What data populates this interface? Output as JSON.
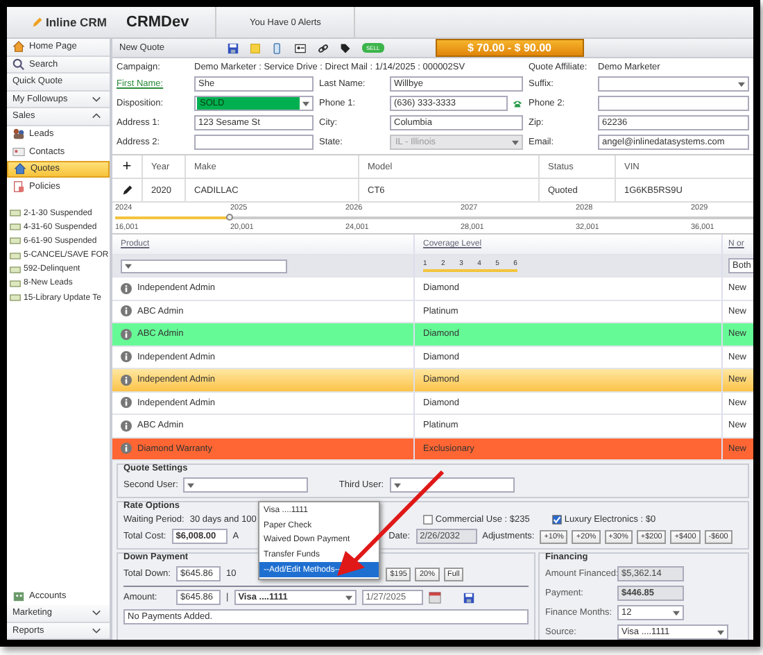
{
  "header": {
    "logo": "Inline CRM",
    "environment": "CRMDev",
    "alerts": "You Have 0 Alerts"
  },
  "sidebar": {
    "nav": [
      {
        "kind": "page",
        "label": "Home Page"
      },
      {
        "kind": "page",
        "label": "Search"
      },
      {
        "kind": "plain",
        "label": "Quick Quote"
      },
      {
        "kind": "group",
        "label": "My Followups",
        "expanded": false
      },
      {
        "kind": "group",
        "label": "Sales",
        "expanded": true
      },
      {
        "kind": "entry",
        "label": "Leads",
        "selected": false
      },
      {
        "kind": "entry",
        "label": "Contacts",
        "selected": false
      },
      {
        "kind": "entry",
        "label": "Quotes",
        "selected": true
      },
      {
        "kind": "entry",
        "label": "Policies",
        "selected": false
      }
    ],
    "queues": [
      "2-1-30 Suspended",
      "4-31-60 Suspended",
      "6-61-90 Suspended",
      "5-CANCEL/SAVE FOR",
      "592-Delinquent",
      "8-New Leads",
      "15-Library Update Te"
    ],
    "footer": [
      {
        "kind": "entry",
        "label": "Accounts",
        "selected": false
      },
      {
        "kind": "group",
        "label": "Marketing",
        "expanded": false
      },
      {
        "kind": "group",
        "label": "Reports",
        "expanded": false
      }
    ]
  },
  "toolbar": {
    "title": "New Quote",
    "badge": "SELL",
    "price": "$ 70.00 - $ 90.00"
  },
  "form": {
    "campaign_label": "Campaign:",
    "campaign": "Demo Marketer : Service Drive : Direct Mail : 1/14/2025 : 000002SV",
    "affiliate_label": "Quote Affiliate:",
    "affiliate": "Demo Marketer",
    "fields": [
      {
        "label": "First Name:",
        "kind": "text",
        "value": "She",
        "link": true,
        "disabled": false
      },
      {
        "label": "Last Name:",
        "kind": "text",
        "value": "Willbye",
        "link": false,
        "disabled": false
      },
      {
        "label": "Suffix:",
        "kind": "select",
        "link": false,
        "disabled": false
      },
      {
        "label": "Disposition:",
        "kind": "select",
        "value": "SOLD",
        "color": "#00b050",
        "link": false,
        "disabled": false
      },
      {
        "label": "Phone 1:",
        "kind": "phone",
        "value": "(636) 333-3333",
        "link": false,
        "disabled": false
      },
      {
        "label": "Phone 2:",
        "kind": "text",
        "link": false,
        "disabled": false
      },
      {
        "label": "Address 1:",
        "kind": "text",
        "value": "123 Sesame St",
        "link": false,
        "disabled": false
      },
      {
        "label": "City:",
        "kind": "text",
        "value": "Columbia",
        "link": false,
        "disabled": false
      },
      {
        "label": "Zip:",
        "kind": "text",
        "value": "62236",
        "link": false,
        "disabled": false
      },
      {
        "label": "Address 2:",
        "kind": "text",
        "link": false,
        "disabled": false
      },
      {
        "label": "State:",
        "kind": "select",
        "value": "IL - Illinois",
        "link": false,
        "disabled": true
      },
      {
        "label": "Email:",
        "kind": "text",
        "value": "angel@inlinedatasystems.com",
        "link": false,
        "disabled": false
      }
    ]
  },
  "vehicles": {
    "add": "+",
    "columns": [
      "Year",
      "Make",
      "Model",
      "Status",
      "VIN"
    ],
    "rows": [
      {
        "cells": [
          "2020",
          "CADILLAC",
          "CT6",
          "Quoted",
          "1G6KB5RS9U"
        ]
      }
    ]
  },
  "timeline": {
    "years": [
      "2024",
      "2025",
      "2026",
      "2027",
      "2028",
      "2029"
    ],
    "miles": [
      "16,001",
      "20,001",
      "24,001",
      "28,001",
      "32,001",
      "36,001"
    ],
    "level": 0.18
  },
  "coverage": {
    "columns": [
      "Product",
      "Coverage Level",
      "N or"
    ],
    "levels": [
      "1",
      "2",
      "3",
      "4",
      "5",
      "6"
    ],
    "level": 1,
    "type_filter": "Both",
    "rows": [
      {
        "product": "Independent Admin",
        "coverage": "Diamond",
        "type": "New",
        "selected": false
      },
      {
        "product": "ABC Admin",
        "coverage": "Platinum",
        "type": "New",
        "selected": false
      },
      {
        "product": "ABC Admin",
        "coverage": "Diamond",
        "type": "New",
        "selected": false,
        "color": "#66fa96"
      },
      {
        "product": "Independent Admin",
        "coverage": "Diamond",
        "type": "New",
        "selected": false
      },
      {
        "product": "Independent Admin",
        "coverage": "Diamond",
        "type": "New",
        "selected": true
      },
      {
        "product": "Independent Admin",
        "coverage": "Diamond",
        "type": "New",
        "selected": false
      },
      {
        "product": "ABC Admin",
        "coverage": "Platinum",
        "type": "New",
        "selected": false
      },
      {
        "product": "Diamond Warranty",
        "coverage": "Exclusionary",
        "type": "New",
        "selected": false,
        "color": "#ff6633"
      }
    ]
  },
  "quote_settings": {
    "title": "Quote Settings",
    "second_user": "Second User:",
    "third_user": "Third User:"
  },
  "rate_options": {
    "title": "Rate Options",
    "waiting_label": "Waiting Period:",
    "waiting": "30 days and 100",
    "checkboxes": [
      {
        "label": "Commercial Use : $235",
        "checked": false
      },
      {
        "label": "Luxury Electronics : $0",
        "checked": true
      }
    ],
    "total_label": "Total Cost:",
    "total": "$6,008.00",
    "cut_label": "A",
    "date_label": "Date:",
    "date": "2/26/2032",
    "adjust_label": "Adjustments:",
    "adjustments": [
      "+10%",
      "+20%",
      "+30%",
      "+$200",
      "+$400",
      "-$600"
    ]
  },
  "down_payment": {
    "title": "Down Payment",
    "total_label": "Total Down:",
    "total": "$645.86",
    "cut_text": "10",
    "buttons": [
      "$195",
      "20%",
      "Full"
    ],
    "amount_label": "Amount:",
    "amount": "$645.86",
    "separator": "|",
    "method": "Visa ....1111",
    "date": "1/27/2025",
    "empty": "No Payments Added."
  },
  "financing": {
    "title": "Financing",
    "rows": [
      {
        "label": "Amount Financed:",
        "value": "$5,362.14",
        "kind": "readonly"
      },
      {
        "label": "Payment:",
        "value": "$446.85",
        "kind": "readonly"
      },
      {
        "label": "Finance Months:",
        "value": "12",
        "kind": "combo"
      },
      {
        "label": "Source:",
        "value": "Visa ....1111",
        "kind": "dropdown"
      }
    ]
  },
  "payment_menu": {
    "options": [
      {
        "label": "Visa ....1111",
        "selected": false
      },
      {
        "label": "Paper Check",
        "selected": false
      },
      {
        "label": "Waived Down Payment",
        "selected": false
      },
      {
        "label": "Transfer Funds",
        "selected": false
      },
      {
        "label": "--Add/Edit Methods--",
        "selected": true
      }
    ]
  }
}
